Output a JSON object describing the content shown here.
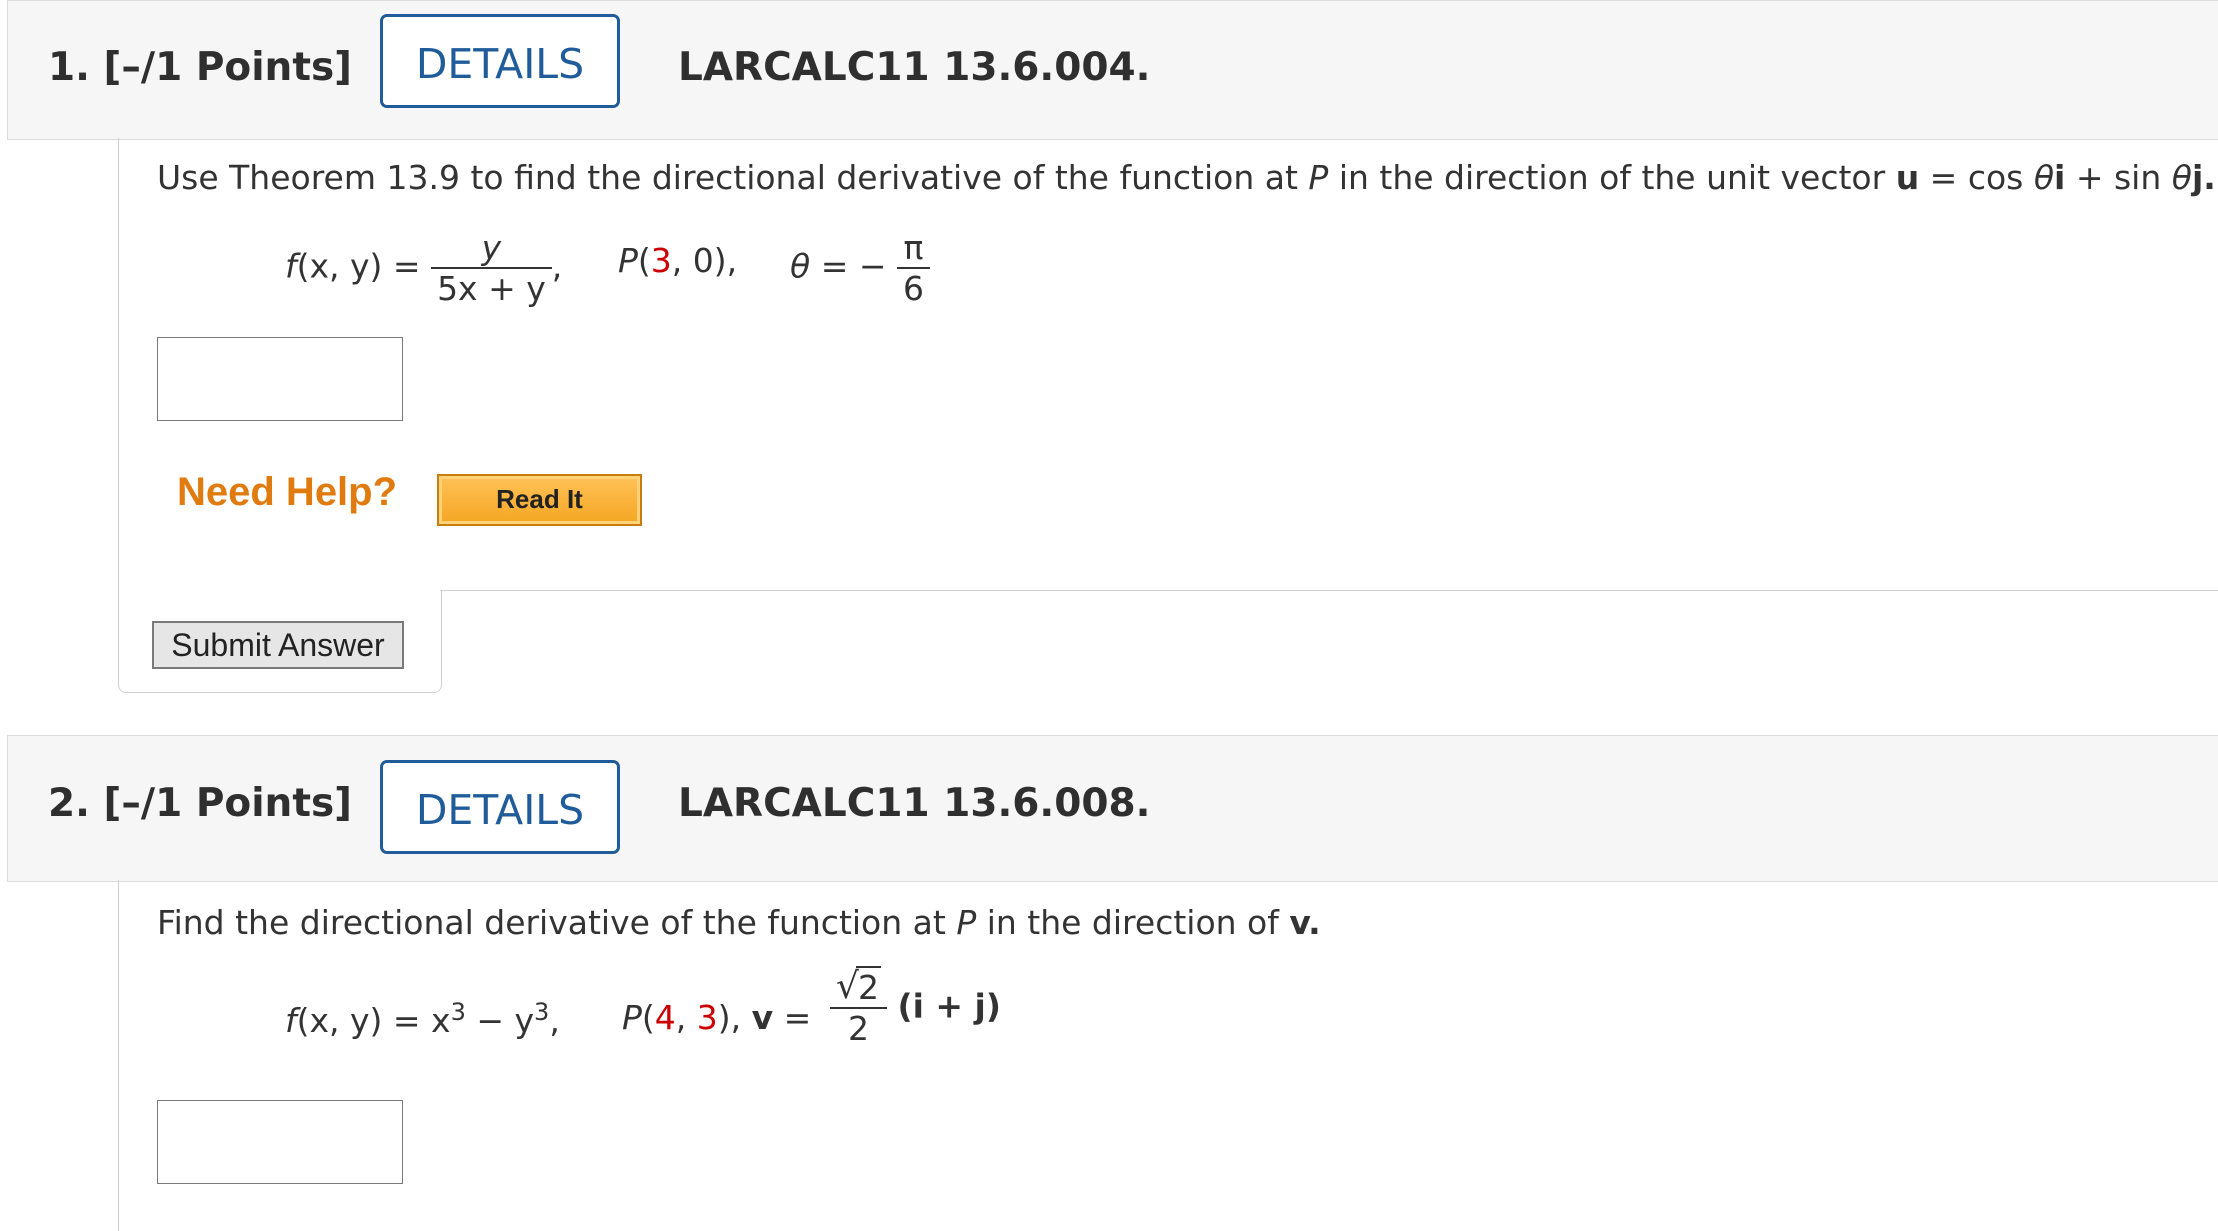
{
  "q1": {
    "number": "1.",
    "points": "[–/1 Points]",
    "details_label": "DETAILS",
    "problem_id": "LARCALC11 13.6.004.",
    "prompt_pre": "Use Theorem 13.9 to find the directional derivative of the function at ",
    "prompt_P": "P",
    "prompt_mid": " in the direction of the unit vector ",
    "prompt_u": "u",
    "prompt_eq": " = cos ",
    "prompt_theta1": "θ",
    "prompt_i": "i",
    "prompt_plus": " + sin ",
    "prompt_theta2": "θ",
    "prompt_j": "j",
    "prompt_end": ".",
    "f_label": "f",
    "f_args": "(x, y) =",
    "f_num": "y",
    "f_den": "5x + y",
    "point_P": "P",
    "point_x": "3",
    "point_y": "0",
    "theta": "θ",
    "theta_eq": " = −",
    "theta_num": "π",
    "theta_den": "6",
    "need_help": "Need Help?",
    "read_it": "Read It",
    "submit": "Submit Answer"
  },
  "q2": {
    "number": "2.",
    "points": "[–/1 Points]",
    "details_label": "DETAILS",
    "problem_id": "LARCALC11 13.6.008.",
    "prompt_pre": "Find the directional derivative of the function at ",
    "prompt_P": "P",
    "prompt_mid": " in the direction of ",
    "prompt_v": "v",
    "prompt_end": ".",
    "f_expr": "(x, y) = x",
    "f_label": "f",
    "exp1": "3",
    "minus": " − y",
    "exp2": "3",
    "comma": ",",
    "point_P": "P",
    "point_x": "4",
    "point_y": "3",
    "v_label": "v",
    "v_eq": " =",
    "sqrt_arg": "2",
    "den": "2",
    "ij": "(i + j)"
  },
  "colors": {
    "accent": "#1f5c99",
    "help": "#e07b10",
    "highlight_red": "#cc0000"
  }
}
